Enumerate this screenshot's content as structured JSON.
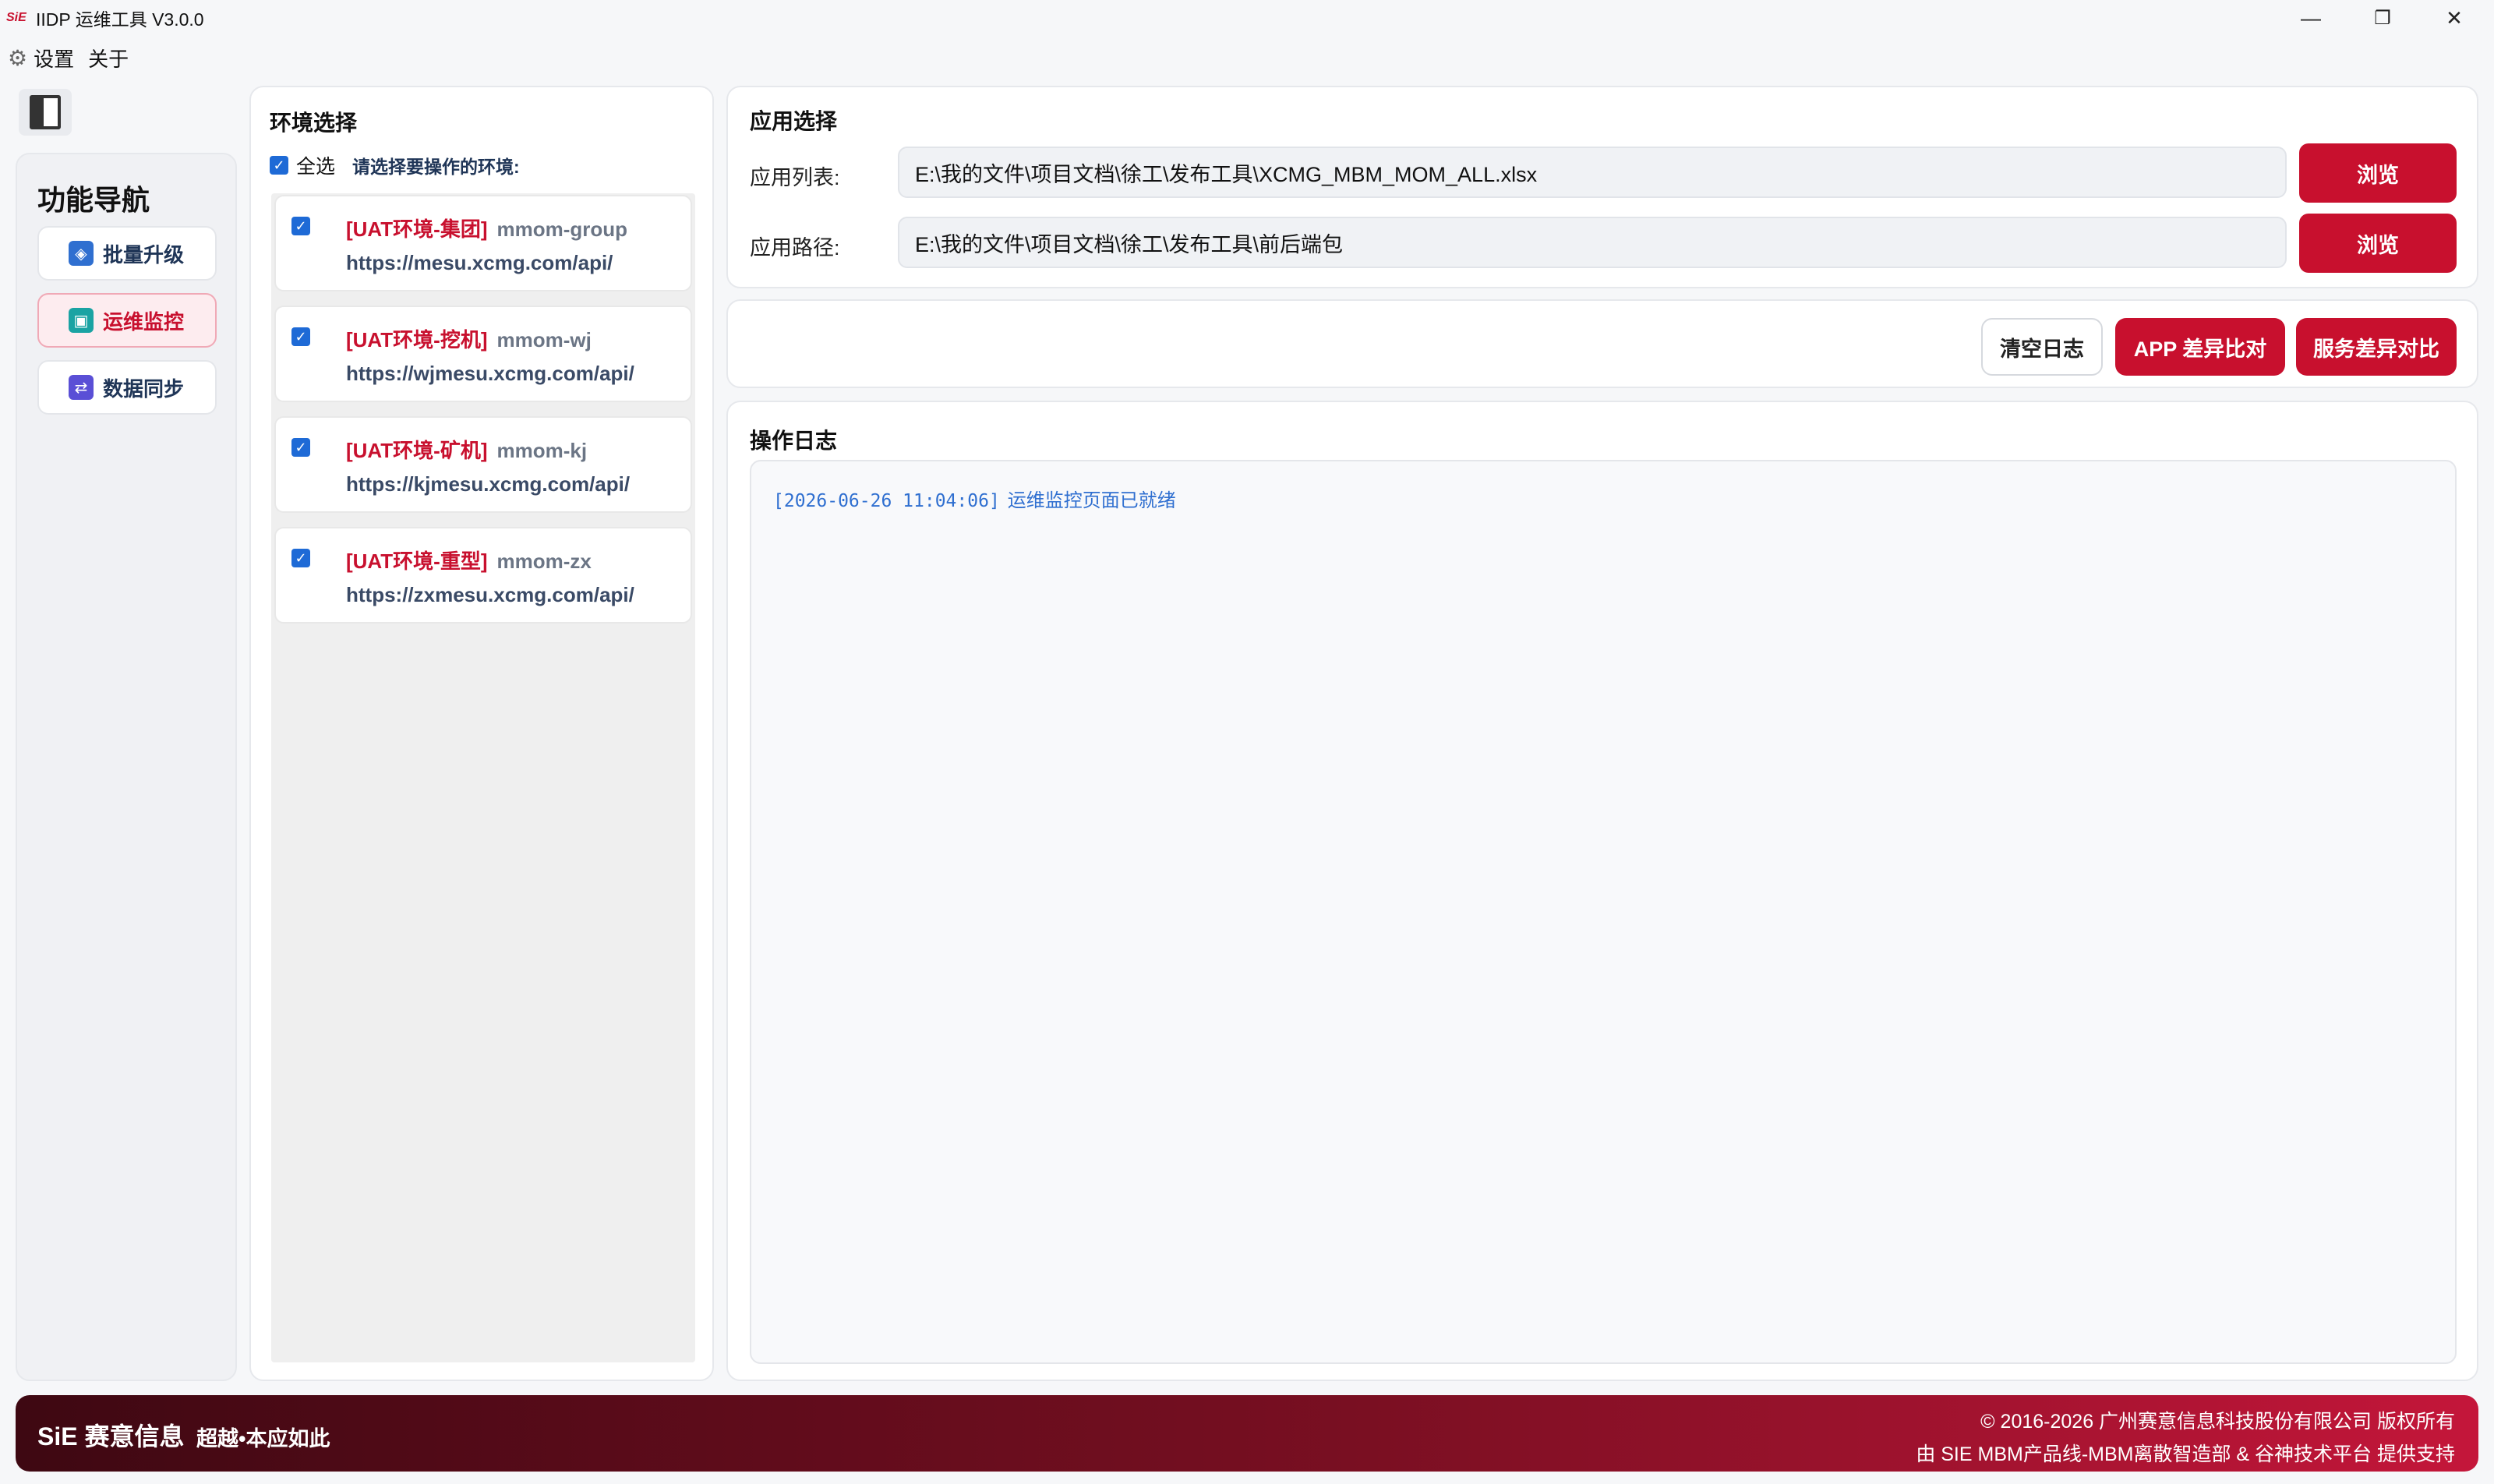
{
  "window": {
    "logo_text": "SiE",
    "title": "IIDP 运维工具 V3.0.0",
    "controls": {
      "minimize": "—",
      "maximize": "❐",
      "close": "✕"
    }
  },
  "menu": {
    "items": [
      {
        "label": "设置"
      },
      {
        "label": "关于"
      }
    ]
  },
  "nav": {
    "title": "功能导航",
    "items": [
      {
        "label": "批量升级",
        "icon": "layers-icon",
        "color": "#2f6fd0"
      },
      {
        "label": "运维监控",
        "icon": "monitor-icon",
        "color": "#1aa3a3",
        "active": true
      },
      {
        "label": "数据同步",
        "icon": "sync-icon",
        "color": "#5a4fd6"
      }
    ]
  },
  "env": {
    "title": "环境选择",
    "select_all_label": "全选",
    "hint": "请选择要操作的环境:",
    "items": [
      {
        "name": "[UAT环境-集团]",
        "code": "mmom-group",
        "url": "https://mesu.xcmg.com/api/",
        "checked": true
      },
      {
        "name": "[UAT环境-挖机]",
        "code": "mmom-wj",
        "url": "https://wjmesu.xcmg.com/api/",
        "checked": true
      },
      {
        "name": "[UAT环境-矿机]",
        "code": "mmom-kj",
        "url": "https://kjmesu.xcmg.com/api/",
        "checked": true
      },
      {
        "name": "[UAT环境-重型]",
        "code": "mmom-zx",
        "url": "https://zxmesu.xcmg.com/api/",
        "checked": true
      }
    ]
  },
  "app": {
    "title": "应用选择",
    "list_label": "应用列表:",
    "list_value": "E:\\我的文件\\项目文档\\徐工\\发布工具\\XCMG_MBM_MOM_ALL.xlsx",
    "path_label": "应用路径:",
    "path_value": "E:\\我的文件\\项目文档\\徐工\\发布工具\\前后端包",
    "browse_label": "浏览"
  },
  "actions": {
    "clear_log": "清空日志",
    "app_diff": "APP 差异比对",
    "service_diff": "服务差异对比"
  },
  "log": {
    "title": "操作日志",
    "entries": [
      {
        "time": "[2026-06-26 11:04:06]",
        "message": "运维监控页面已就绪"
      }
    ]
  },
  "footer": {
    "brand": "SiE 赛意信息",
    "slogan": "超越•本应如此",
    "copyright": "© 2016-2026 广州赛意信息科技股份有限公司 版权所有",
    "credit": "由 SIE MBM产品线-MBM离散智造部 & 谷神技术平台 提供支持"
  },
  "colors": {
    "accent": "#c8102e",
    "checkbox": "#1e6ad6",
    "log_text": "#2f6fd0"
  }
}
